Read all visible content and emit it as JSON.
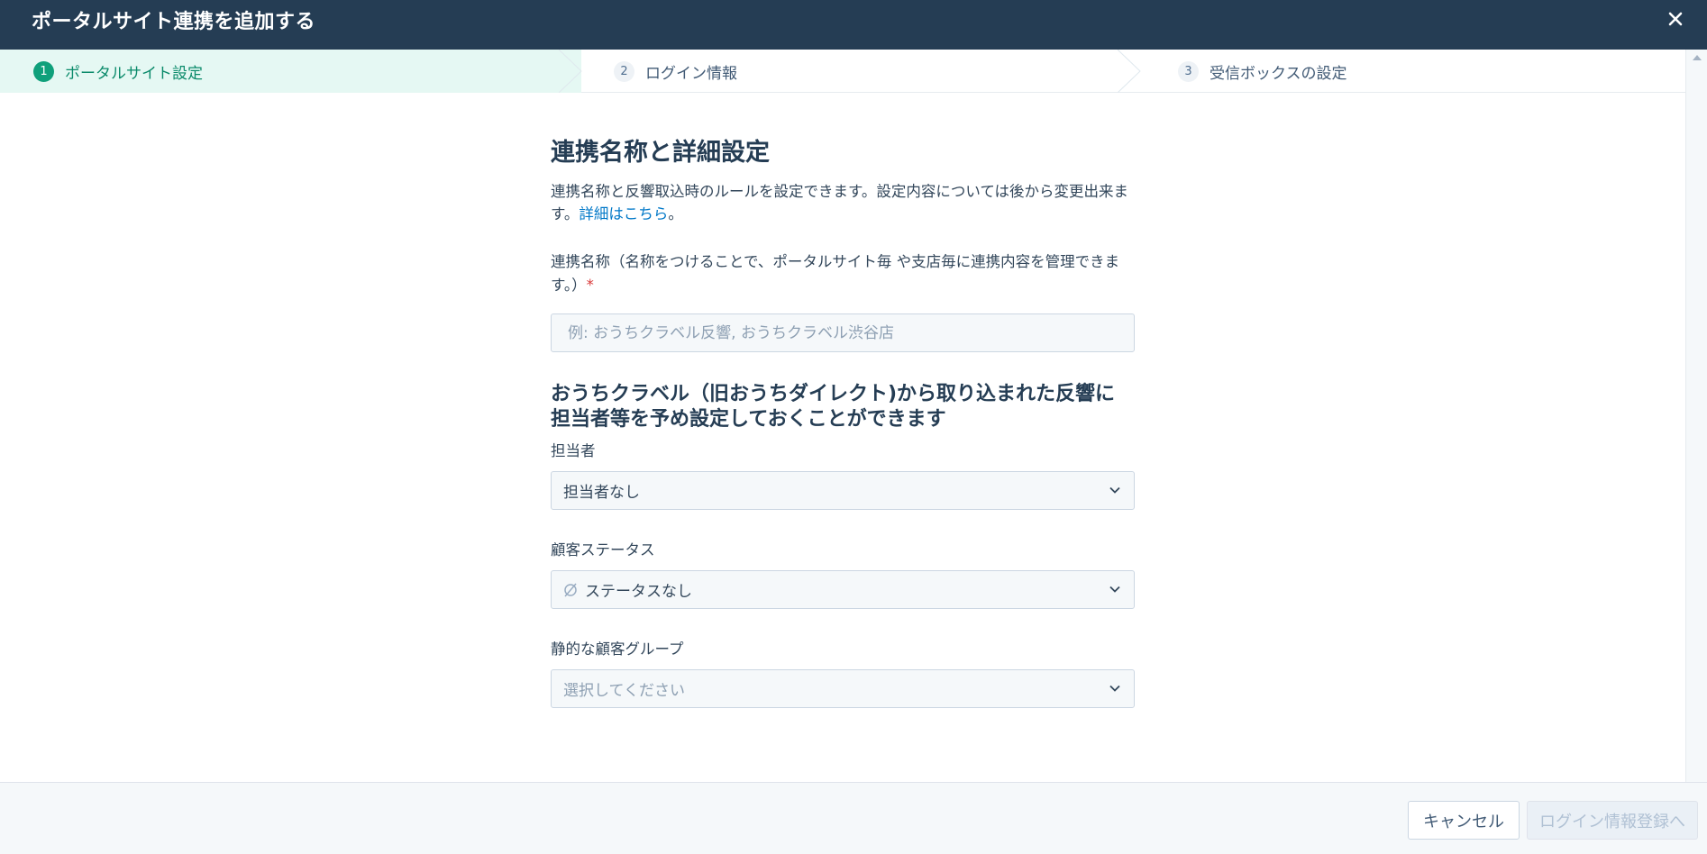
{
  "header": {
    "title": "ポータルサイト連携を追加する",
    "close_icon": "close-icon"
  },
  "stepper": {
    "steps": [
      {
        "number": "1",
        "label": "ポータルサイト設定",
        "active": true
      },
      {
        "number": "2",
        "label": "ログイン情報",
        "active": false
      },
      {
        "number": "3",
        "label": "受信ボックスの設定",
        "active": false
      }
    ]
  },
  "main": {
    "title": "連携名称と詳細設定",
    "description_text": "連携名称と反響取込時のルールを設定できます。設定内容については後から変更出来ます。",
    "description_link": "詳細はこちら",
    "description_end": "。",
    "name_field": {
      "label": "連携名称（名称をつけることで、ポータルサイト毎 や支店毎に連携内容を管理できます。）",
      "required_mark": "*",
      "placeholder": "例: おうちクラベル反響, おうちクラベル渋谷店",
      "value": ""
    },
    "subsection_title": "おうちクラベル（旧おうちダイレクト)から取り込まれた反響に担当者等を予め設定しておくことができます",
    "owner": {
      "label": "担当者",
      "value": "担当者なし"
    },
    "customer_status": {
      "label": "顧客ステータス",
      "value": "ステータスなし",
      "icon": "no-status-icon"
    },
    "static_group": {
      "label": "静的な顧客グループ",
      "placeholder": "選択してください"
    }
  },
  "footer": {
    "cancel_label": "キャンセル",
    "next_label": "ログイン情報登録へ"
  },
  "colors": {
    "header_bg": "#253d54",
    "active_step_bg": "#e5f8f3",
    "active_step_accent": "#0fa07b",
    "link": "#0078c8",
    "required": "#d93a3a"
  }
}
